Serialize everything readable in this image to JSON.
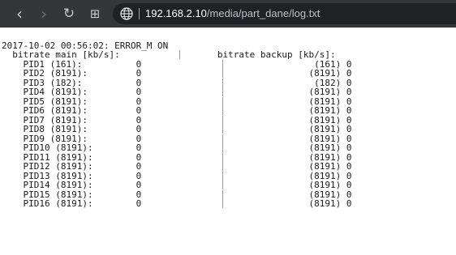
{
  "toolbar": {
    "back_icon": "‹",
    "forward_icon": "›",
    "reload_icon": "↻",
    "apps_icon": "⊞",
    "url_host": "192.168.2.10",
    "url_path": "/media/part_dane/log.txt"
  },
  "log": {
    "timestamp_line": "2017-10-02 00:56:02: ERROR_M ON",
    "header_main": "bitrate main [kb/s]:",
    "header_backup": "bitrate backup [kb/s]:",
    "rows": [
      {
        "pid": "PID1 (161):",
        "main": "0",
        "backup": "(161) 0"
      },
      {
        "pid": "PID2 (8191):",
        "main": "0",
        "backup": "(8191) 0"
      },
      {
        "pid": "PID3 (182):",
        "main": "0",
        "backup": "(182) 0"
      },
      {
        "pid": "PID4 (8191):",
        "main": "0",
        "backup": "(8191) 0"
      },
      {
        "pid": "PID5 (8191):",
        "main": "0",
        "backup": "(8191) 0"
      },
      {
        "pid": "PID6 (8191):",
        "main": "0",
        "backup": "(8191) 0"
      },
      {
        "pid": "PID7 (8191):",
        "main": "0",
        "backup": "(8191) 0"
      },
      {
        "pid": "PID8 (8191):",
        "main": "0",
        "backup": "(8191) 0"
      },
      {
        "pid": "PID9 (8191):",
        "main": "0",
        "backup": "(8191) 0"
      },
      {
        "pid": "PID10 (8191):",
        "main": "0",
        "backup": "(8191) 0"
      },
      {
        "pid": "PID11 (8191):",
        "main": "0",
        "backup": "(8191) 0"
      },
      {
        "pid": "PID12 (8191):",
        "main": "0",
        "backup": "(8191) 0"
      },
      {
        "pid": "PID13 (8191):",
        "main": "0",
        "backup": "(8191) 0"
      },
      {
        "pid": "PID14 (8191):",
        "main": "0",
        "backup": "(8191) 0"
      },
      {
        "pid": "PID15 (8191):",
        "main": "0",
        "backup": "(8191) 0"
      },
      {
        "pid": "PID16 (8191):",
        "main": "0",
        "backup": "(8191) 0"
      }
    ]
  }
}
